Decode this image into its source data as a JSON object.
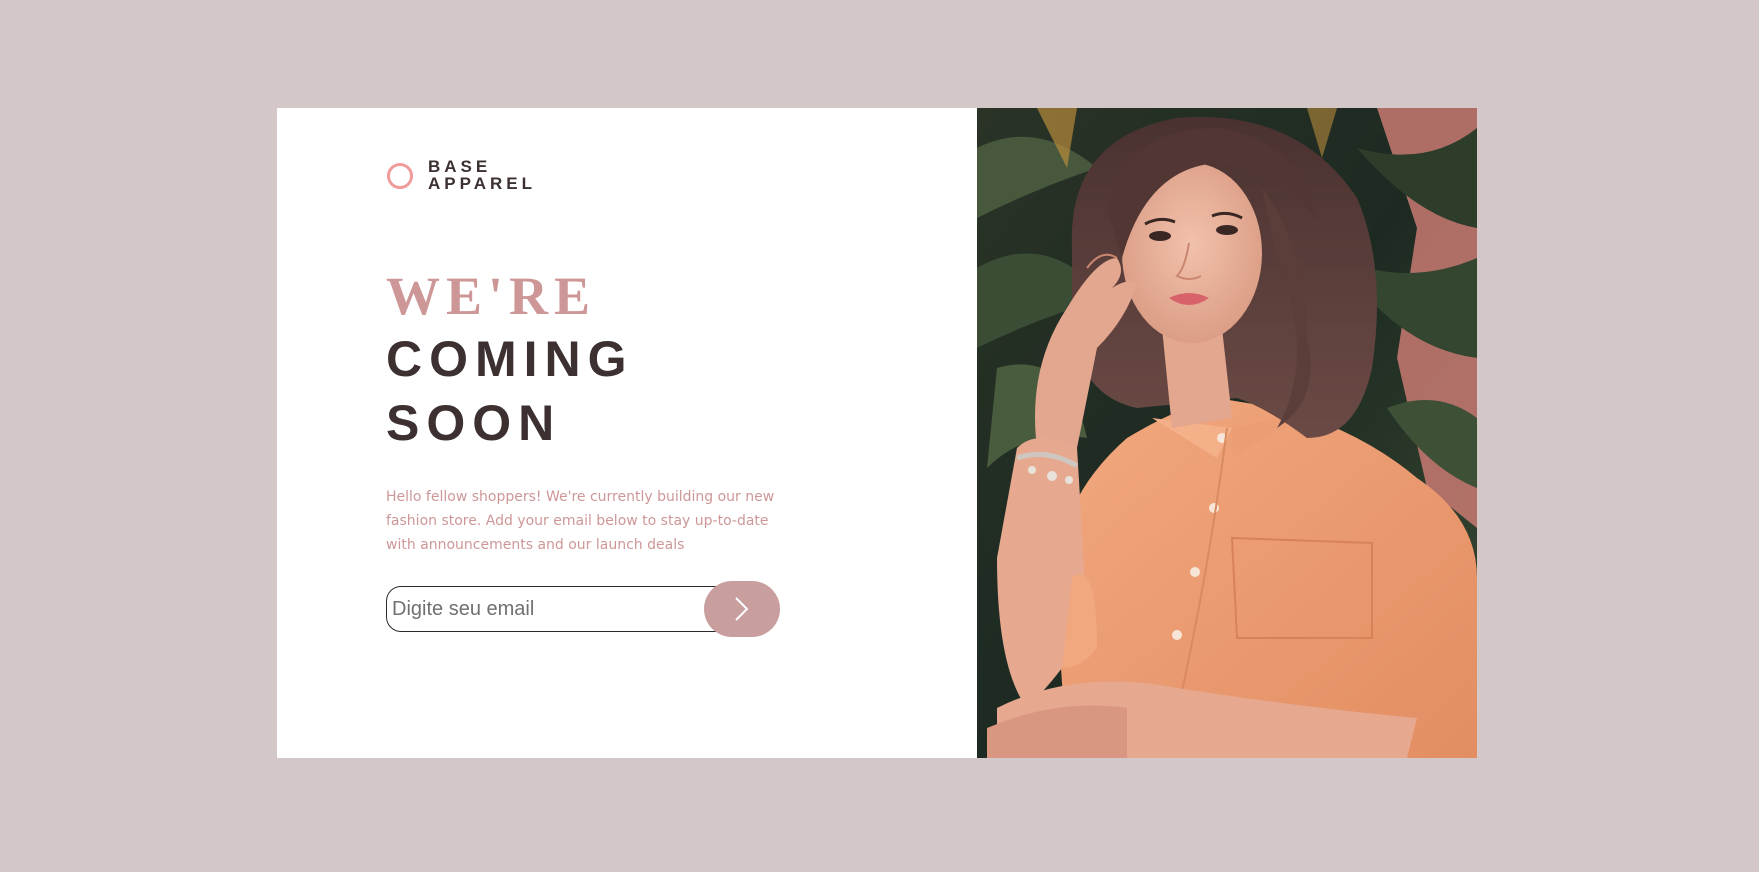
{
  "brand": {
    "line1": "BASE",
    "line2": "APPAREL",
    "accent_color": "#f29a9a"
  },
  "headline": {
    "line1": "WE'RE",
    "line2": "COMING",
    "line3": "SOON"
  },
  "description": "Hello fellow shoppers! We're currently building our new fashion store. Add your email below to stay up-to-date with announcements and our launch deals",
  "form": {
    "email_placeholder": "Digite seu email",
    "email_value": "",
    "submit_icon": "chevron-right-icon"
  },
  "hero_image": {
    "subject": "hero-photo"
  },
  "colors": {
    "background": "#d3c7c7",
    "card": "#ffffff",
    "primary_pink": "#ce9797",
    "dark_text": "#3d3030",
    "button": "#c89e9e"
  }
}
